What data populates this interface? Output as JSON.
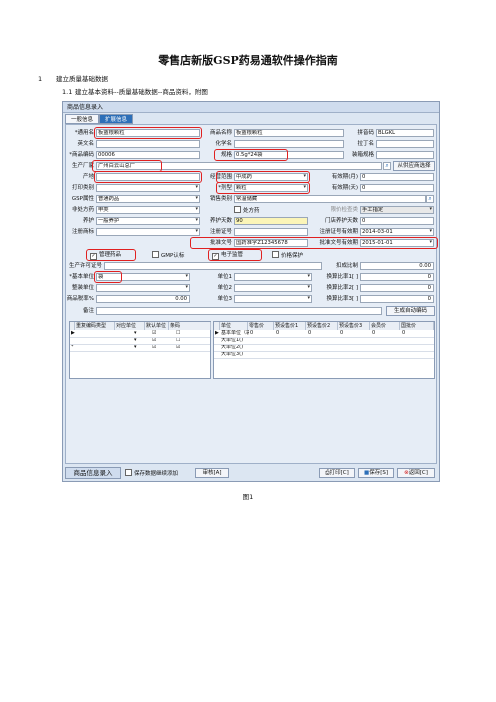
{
  "doc": {
    "title": "零售店新版GSP药易通软件操作指南",
    "section": {
      "num": "1",
      "text": "建立质量基础数据"
    },
    "subsection": {
      "num": "1.1",
      "text": "建立基本资料--质量基础数据--商品资料，附图"
    },
    "caption": "图1"
  },
  "window": {
    "title": "商品信息录入",
    "tabs": [
      "一般信息",
      "扩展信息"
    ]
  },
  "form": {
    "generic_name": {
      "label": "*通用名",
      "value": "板蓝根颗粒"
    },
    "product_name": {
      "label": "商品名称",
      "value": "板蓝根颗粒"
    },
    "pinyin": {
      "label": "拼音码",
      "value": "BLGKL"
    },
    "english_name": {
      "label": "英文名"
    },
    "chemical_name": {
      "label": "化学名"
    },
    "latin_name": {
      "label": "拉丁名"
    },
    "product_code": {
      "label": "*商品编码",
      "value": "00006"
    },
    "spec": {
      "label": "规格",
      "value": "0.5g*24袋"
    },
    "package_spec": {
      "label": "装箱规格"
    },
    "manufacturer": {
      "label": "生产厂家",
      "value": "广州白云山总厂",
      "button": "从供应商选择"
    },
    "origin": {
      "label": "产地"
    },
    "business_scope": {
      "label": "经营范围",
      "value": "中成药"
    },
    "validity_month": {
      "label": "有效期(月)",
      "value": "0"
    },
    "print_category": {
      "label": "打印类别"
    },
    "dosage_form": {
      "label": "*剂型",
      "value": "颗粒"
    },
    "validity_day": {
      "label": "有效期(天)",
      "value": "0"
    },
    "gsp_attr": {
      "label": "GSP属性",
      "value": "普通药品"
    },
    "sales_category": {
      "label": "销售类别",
      "value": "常温储藏"
    },
    "otc_drug": {
      "label": "非处方药",
      "value": "甲类"
    },
    "prescription": {
      "label": "处方药"
    },
    "limit_model": {
      "label": "限价检查类",
      "value": "手工指定"
    },
    "maintenance": {
      "label": "养护",
      "value": "一般养护"
    },
    "maintenance_days": {
      "label": "养护天数",
      "value": "90"
    },
    "store_maintenance_days": {
      "label": "门店养护天数",
      "value": "0"
    },
    "trademark": {
      "label": "注册商标"
    },
    "reg_cert": {
      "label": "注册证号"
    },
    "reg_valid": {
      "label": "注册证号有效期",
      "value": "2014-03-01"
    },
    "approval_no": {
      "label": "批准文号",
      "value": "国药准字Z12345678"
    },
    "approval_valid": {
      "label": "批准文号有效期",
      "value": "2015-01-01"
    },
    "chk_controlled": "管理药品",
    "chk_gmp": "GMP认标",
    "chk_esupervision": "电子监管",
    "chk_price_protect": "价格保护",
    "license_no": {
      "label": "生产许可证号"
    },
    "deduct_ratio": {
      "label": "扣成比制",
      "value": "0.00"
    },
    "base_unit": {
      "label": "*基本单位",
      "value": "袋"
    },
    "unit1": {
      "label": "单位1"
    },
    "unit2": {
      "label": "单位2"
    },
    "unit3": {
      "label": "单位3"
    },
    "ratio1": {
      "label": "换算比率1[ ]",
      "value": "0"
    },
    "ratio2": {
      "label": "换算比率2[ ]",
      "value": "0"
    },
    "ratio3": {
      "label": "换算比率3[ ]",
      "value": "0"
    },
    "storage_unit": {
      "label": "整装单位"
    },
    "tax_rate": {
      "label": "商品税率%",
      "value": "0.00"
    },
    "remark": {
      "label": "备注"
    },
    "auto_code_button": "生成自动编码"
  },
  "left_grid": {
    "headers": [
      "重复编码类型",
      "对应单位",
      "默认单位",
      "条码"
    ]
  },
  "right_grid": {
    "headers": [
      "单位",
      "零售价",
      "预设售价1",
      "预设售价2",
      "预设售价3",
      "会员价",
      "国批价"
    ],
    "rows": [
      {
        "unit": "基本单位（袋）",
        "values": [
          "0",
          "0",
          "0",
          "0",
          "0",
          "0"
        ]
      },
      {
        "unit": "大单位1()",
        "values": []
      },
      {
        "unit": "大单位2()",
        "values": []
      },
      {
        "unit": "大单位3()",
        "values": []
      }
    ]
  },
  "bottom": {
    "tab": "商品信息录入",
    "continue_add": "保存数据继续添加",
    "audit_button": "审核[A]",
    "print_button": "打印[C]",
    "save_button": "保存[S]",
    "back_button": "返回[C]"
  }
}
